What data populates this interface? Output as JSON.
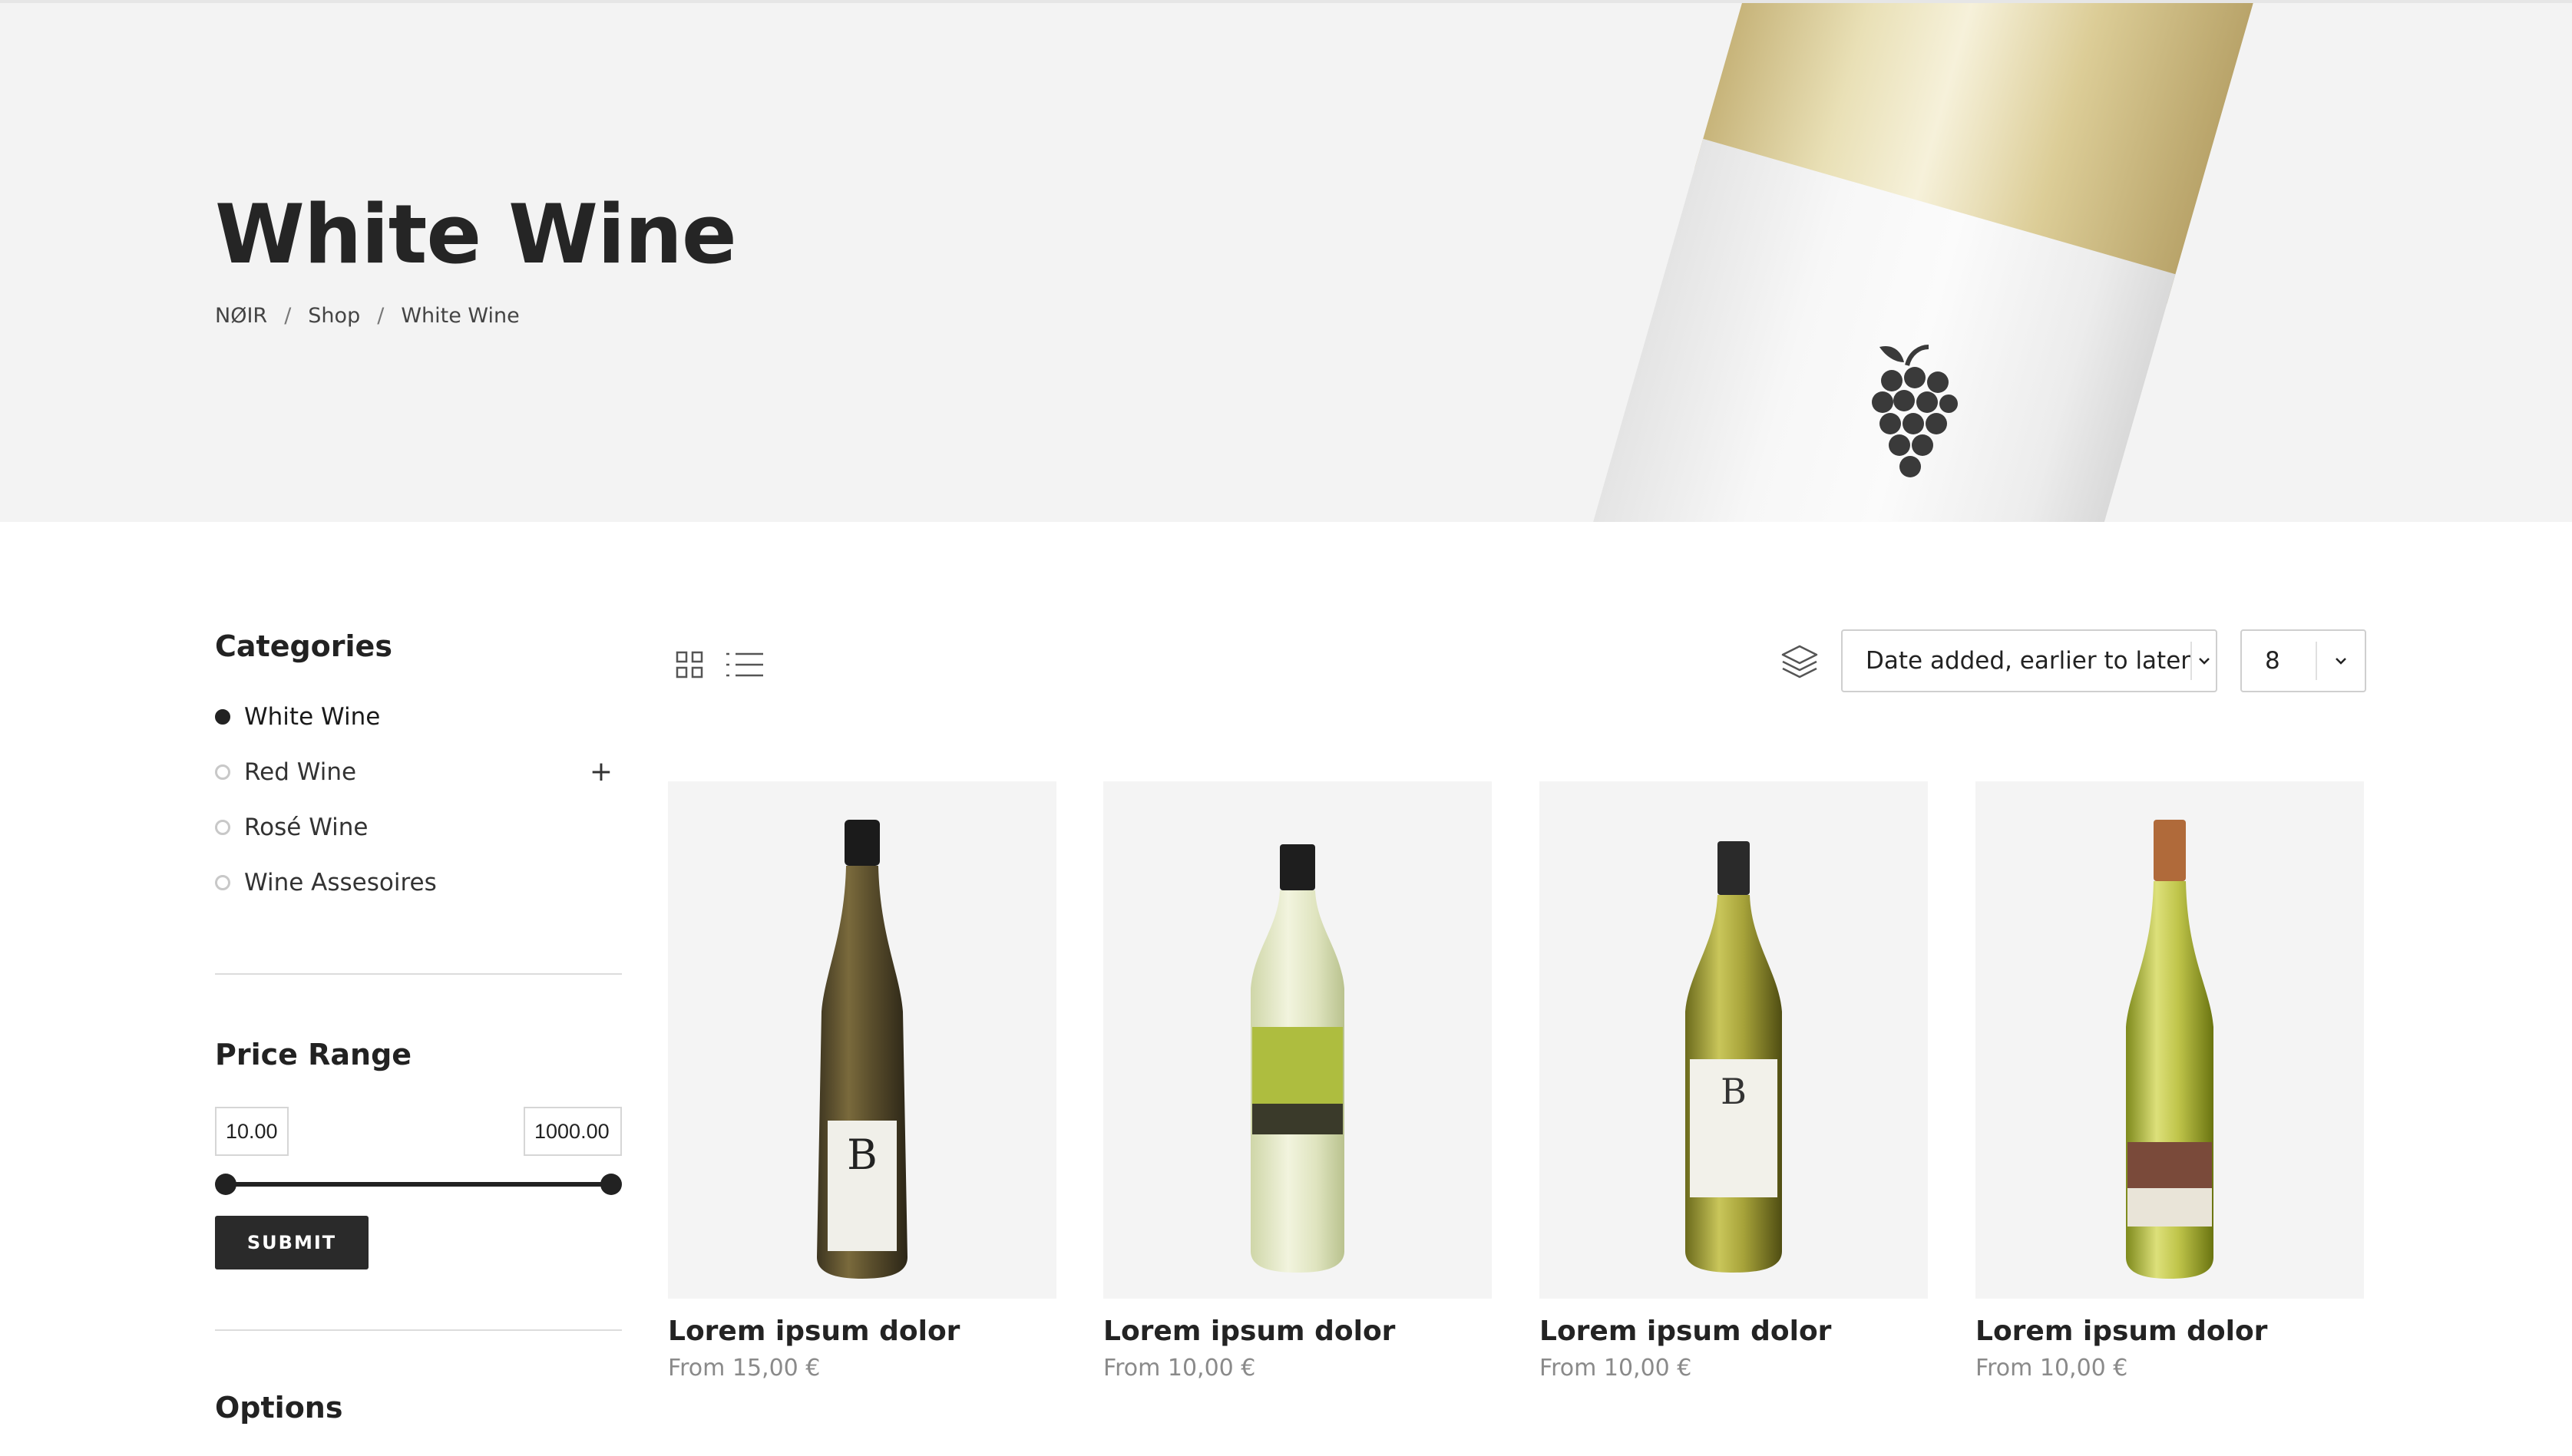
{
  "hero": {
    "title": "White Wine",
    "breadcrumb": [
      "NØIR",
      "Shop",
      "White Wine"
    ],
    "separator": "/"
  },
  "sidebar": {
    "categories_heading": "Categories",
    "categories": [
      {
        "label": "White Wine",
        "active": true
      },
      {
        "label": "Red Wine",
        "active": false,
        "expandable": true
      },
      {
        "label": "Rosé Wine",
        "active": false
      },
      {
        "label": "Wine Assesoires",
        "active": false
      }
    ],
    "price_heading": "Price Range",
    "price_min": "10.00",
    "price_max": "1000.00",
    "submit_label": "SUBMIT",
    "options_heading": "Options"
  },
  "toolbar": {
    "sort_value": "Date added, earlier to later",
    "per_page_value": "8",
    "icons": [
      "grid-view-icon",
      "list-view-icon",
      "layers-icon",
      "chevron-down-icon"
    ]
  },
  "products": [
    {
      "name": "Lorem ipsum dolor",
      "price": "From 15,00 €"
    },
    {
      "name": "Lorem ipsum dolor",
      "price": "From 10,00 €"
    },
    {
      "name": "Lorem ipsum dolor",
      "price": "From 10,00 €"
    },
    {
      "name": "Lorem ipsum dolor",
      "price": "From 10,00 €"
    }
  ],
  "colors": {
    "hero_bg": "#f3f3f3",
    "text_dark": "#252525",
    "price_gray": "#8a8a8a",
    "button_bg": "#2a2a2a",
    "card_bg": "#f4f4f4"
  }
}
